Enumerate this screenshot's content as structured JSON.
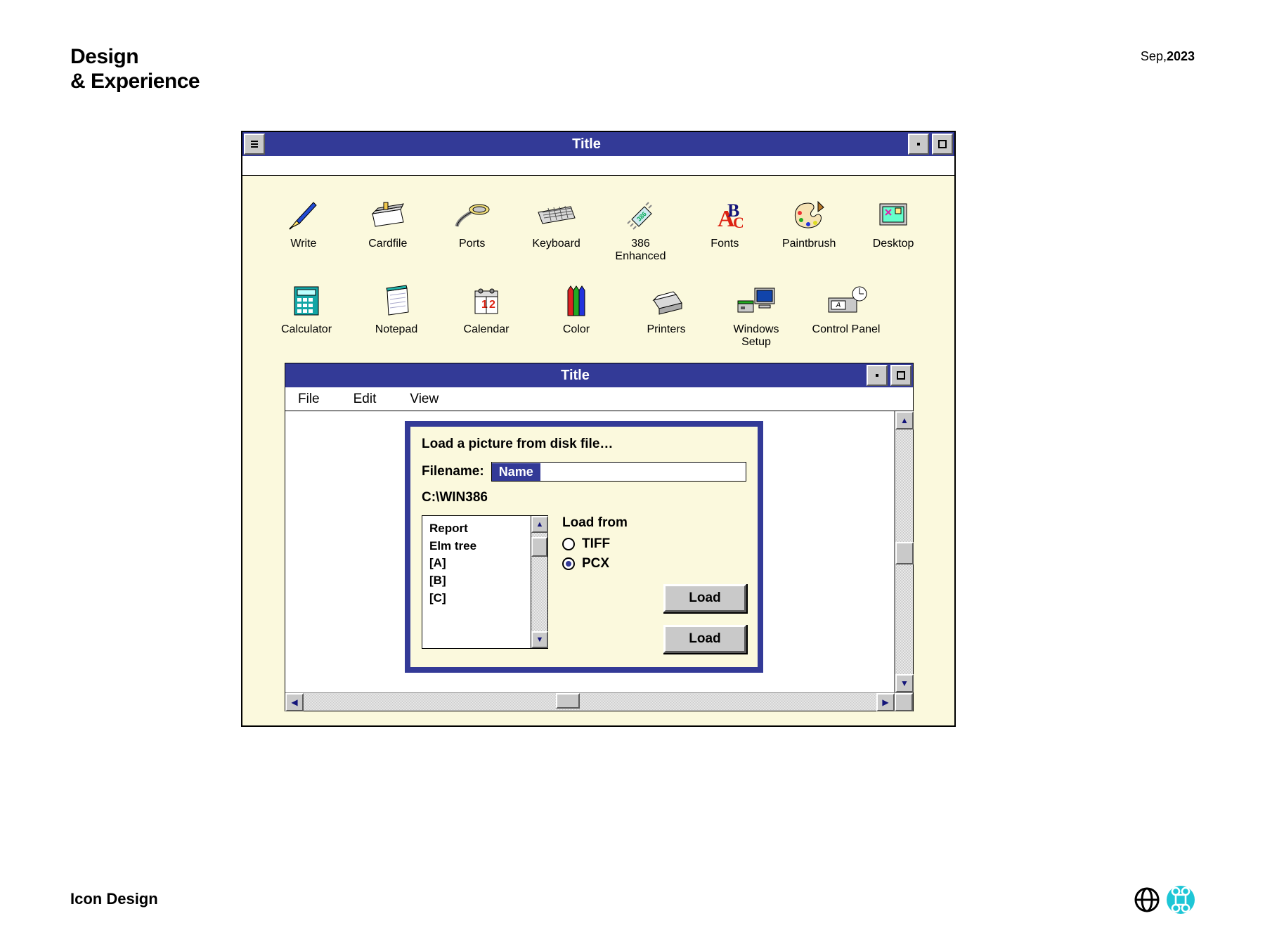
{
  "page": {
    "heading_line1": "Design",
    "heading_line2": "& Experience",
    "date_month": "Sep,",
    "date_year": "2023",
    "footer": "Icon Design"
  },
  "outer_window": {
    "title": "Title",
    "icons_row1": [
      {
        "label": "Write"
      },
      {
        "label": "Cardfile"
      },
      {
        "label": "Ports"
      },
      {
        "label": "Keyboard"
      },
      {
        "label": "386 Enhanced"
      },
      {
        "label": "Fonts"
      },
      {
        "label": "Paintbrush"
      },
      {
        "label": "Desktop"
      }
    ],
    "icons_row2": [
      {
        "label": "Calculator"
      },
      {
        "label": "Notepad"
      },
      {
        "label": "Calendar"
      },
      {
        "label": "Color"
      },
      {
        "label": "Printers"
      },
      {
        "label": "Windows Setup"
      },
      {
        "label": "Control Panel"
      }
    ]
  },
  "inner_window": {
    "title": "Title",
    "menu": {
      "file": "File",
      "edit": "Edit",
      "view": "View"
    }
  },
  "dialog": {
    "heading": "Load a picture from disk file…",
    "filename_label": "Filename:",
    "filename_value": "Name",
    "path": "C:\\WIN386",
    "list": [
      "Report",
      "Elm tree",
      "[A]",
      "[B]",
      "[C]"
    ],
    "load_from_label": "Load from",
    "radios": [
      {
        "label": "TIFF",
        "checked": false
      },
      {
        "label": "PCX",
        "checked": true
      }
    ],
    "button1": "Load",
    "button2": "Load"
  }
}
